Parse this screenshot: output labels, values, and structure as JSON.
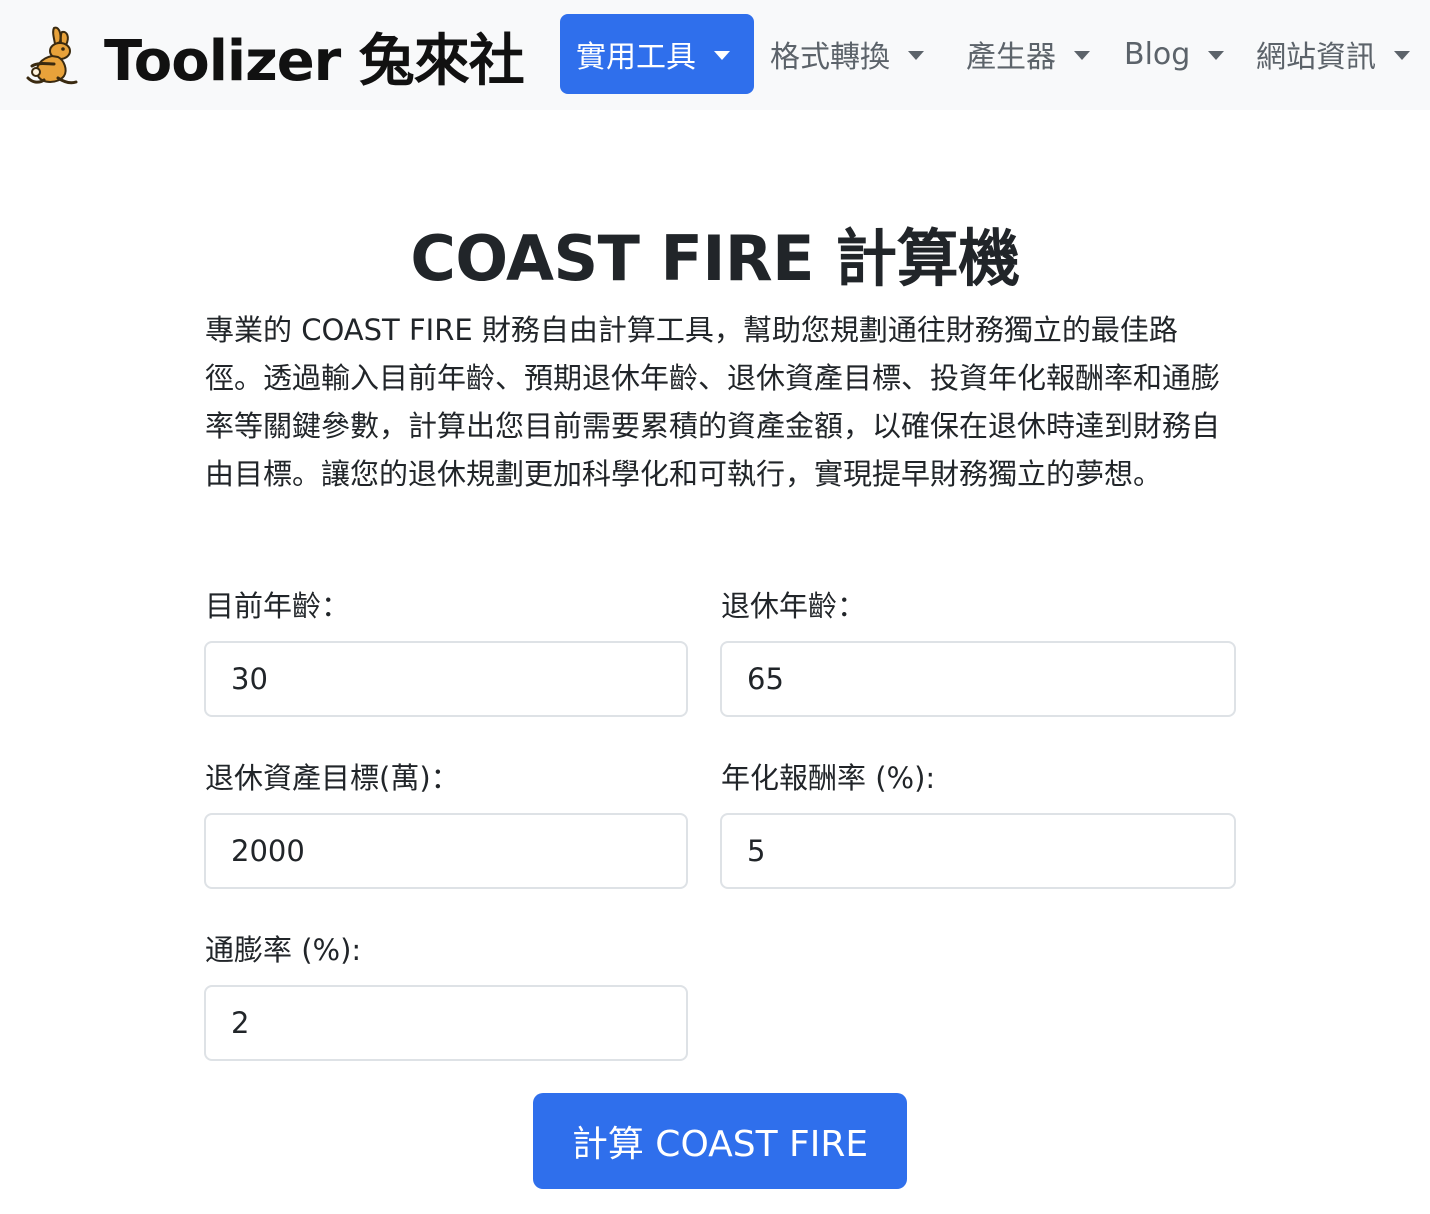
{
  "brand": {
    "name": "Toolizer 兔來社",
    "logo_icon": "rabbit-icon",
    "logo_color": "#e8a23a"
  },
  "nav": {
    "items": [
      {
        "label": "實用工具",
        "active": true
      },
      {
        "label": "格式轉換",
        "active": false
      },
      {
        "label": "產生器",
        "active": false
      },
      {
        "label": "Blog",
        "active": false
      },
      {
        "label": "網站資訊",
        "active": false
      }
    ]
  },
  "main": {
    "title": "COAST FIRE 計算機",
    "description": "專業的 COAST FIRE 財務自由計算工具，幫助您規劃通往財務獨立的最佳路徑。透過輸入目前年齡、預期退休年齡、退休資產目標、投資年化報酬率和通膨率等關鍵參數，計算出您目前需要累積的資產金額，以確保在退休時達到財務自由目標。讓您的退休規劃更加科學化和可執行，實現提早財務獨立的夢想。"
  },
  "form": {
    "current_age": {
      "label": "目前年齡：",
      "value": "30"
    },
    "retire_age": {
      "label": "退休年齡：",
      "value": "65"
    },
    "asset_goal": {
      "label": "退休資產目標(萬)：",
      "value": "2000"
    },
    "return_rate": {
      "label": "年化報酬率 (%):",
      "value": "5"
    },
    "inflation": {
      "label": "通膨率 (%):",
      "value": "2"
    },
    "submit_label": "計算 COAST FIRE"
  },
  "colors": {
    "primary": "#2f6fec",
    "navbar_bg": "#f8f9fa",
    "nav_text": "#5c636a",
    "input_border": "#dee2e6"
  }
}
